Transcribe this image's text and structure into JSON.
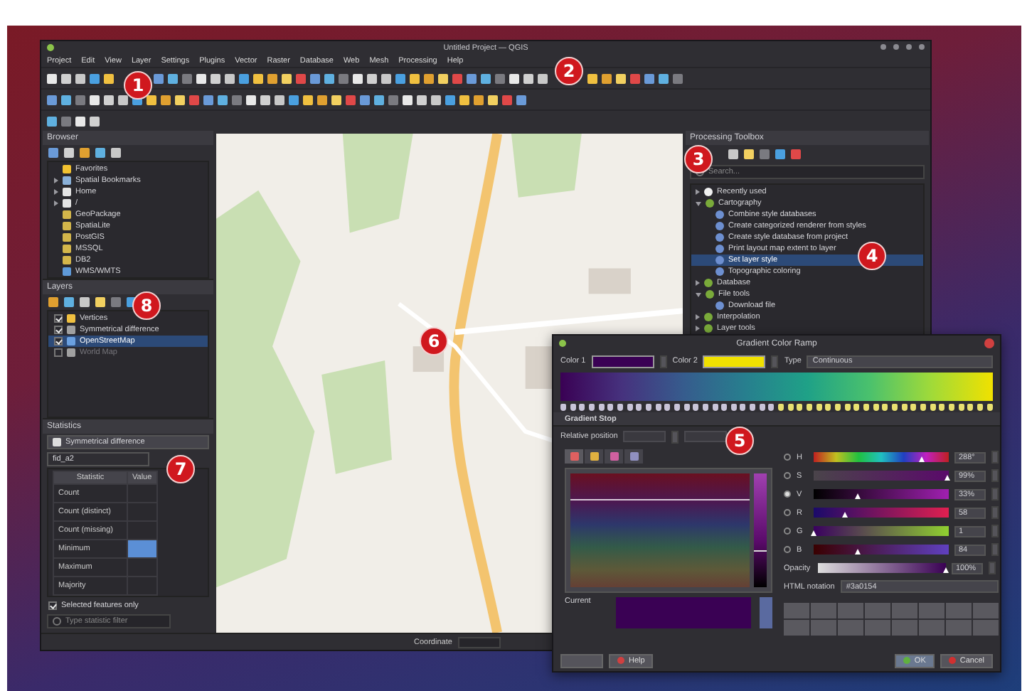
{
  "window": {
    "title": "Untitled Project — QGIS"
  },
  "menu": [
    "Project",
    "Edit",
    "View",
    "Layer",
    "Settings",
    "Plugins",
    "Vector",
    "Raster",
    "Database",
    "Web",
    "Mesh",
    "Processing",
    "Help"
  ],
  "browser": {
    "title": "Browser",
    "items": [
      {
        "label": "Favorites",
        "has_children": false,
        "kind": "star"
      },
      {
        "label": "Spatial Bookmarks",
        "has_children": true,
        "kind": "bookmark"
      },
      {
        "label": "Home",
        "has_children": true,
        "kind": "folder"
      },
      {
        "label": "/",
        "has_children": true,
        "kind": "folder"
      },
      {
        "label": "GeoPackage",
        "has_children": false,
        "kind": "database"
      },
      {
        "label": "SpatiaLite",
        "has_children": false,
        "kind": "database"
      },
      {
        "label": "PostGIS",
        "has_children": false,
        "kind": "database"
      },
      {
        "label": "MSSQL",
        "has_children": false,
        "kind": "database"
      },
      {
        "label": "DB2",
        "has_children": false,
        "kind": "database"
      },
      {
        "label": "WMS/WMTS",
        "has_children": false,
        "kind": "globe"
      }
    ]
  },
  "layers": {
    "title": "Layers",
    "items": [
      {
        "label": "Vertices",
        "checked": true,
        "selected": false,
        "kind": "point"
      },
      {
        "label": "Symmetrical difference",
        "checked": true,
        "selected": false,
        "kind": "polygon"
      },
      {
        "label": "OpenStreetMap",
        "checked": true,
        "selected": true,
        "kind": "tiles"
      },
      {
        "label": "World Map",
        "checked": false,
        "selected": false,
        "kind": "polygon"
      }
    ]
  },
  "statistics": {
    "title": "Statistics",
    "layer": "Symmetrical difference",
    "field": "fid_a2",
    "columns": [
      "Statistic",
      "Value"
    ],
    "rows": [
      {
        "name": "Count",
        "highlighted": false
      },
      {
        "name": "Count (distinct)",
        "highlighted": false
      },
      {
        "name": "Count (missing)",
        "highlighted": false
      },
      {
        "name": "Minimum",
        "highlighted": true
      },
      {
        "name": "Maximum",
        "highlighted": false
      },
      {
        "name": "Majority",
        "highlighted": false
      }
    ],
    "selected_only": {
      "label": "Selected features only",
      "checked": true
    },
    "filter": {
      "placeholder": "Type statistic filter"
    }
  },
  "processing": {
    "title": "Processing Toolbox",
    "search": {
      "placeholder": "Search..."
    },
    "tree": [
      {
        "label": "Recently used",
        "kind": "clock",
        "expanded": false,
        "selected": false
      },
      {
        "label": "Cartography",
        "kind": "group",
        "expanded": true,
        "selected": false,
        "children": [
          {
            "label": "Combine style databases",
            "kind": "algorithm",
            "selected": false
          },
          {
            "label": "Create categorized renderer from styles",
            "kind": "algorithm",
            "selected": false
          },
          {
            "label": "Create style database from project",
            "kind": "algorithm",
            "selected": false
          },
          {
            "label": "Print layout map extent to layer",
            "kind": "algorithm",
            "selected": false
          },
          {
            "label": "Set layer style",
            "kind": "algorithm",
            "selected": true
          },
          {
            "label": "Topographic coloring",
            "kind": "algorithm",
            "selected": false
          }
        ]
      },
      {
        "label": "Database",
        "kind": "group",
        "expanded": false,
        "selected": false
      },
      {
        "label": "File tools",
        "kind": "group",
        "expanded": true,
        "selected": false,
        "children": [
          {
            "label": "Download file",
            "kind": "algorithm",
            "selected": false
          }
        ]
      },
      {
        "label": "Interpolation",
        "kind": "group",
        "expanded": false,
        "selected": false
      },
      {
        "label": "Layer tools",
        "kind": "group",
        "expanded": false,
        "selected": false
      }
    ]
  },
  "status_bar": {
    "coordinate_label": "Coordinate"
  },
  "dialog": {
    "title": "Gradient Color Ramp",
    "colors": [
      {
        "label": "Color 1",
        "color": "#3a0154"
      },
      {
        "label": "Color 2",
        "color": "#f0e100"
      }
    ],
    "type": {
      "label": "Type",
      "value": "Continuous"
    },
    "section": "Gradient Stop",
    "value_slider": {
      "level": 0.33
    },
    "picker_tabs": [
      {
        "selected": true
      },
      {
        "selected": false
      },
      {
        "selected": false
      },
      {
        "selected": false
      }
    ],
    "relative_position": {
      "label": "Relative position"
    },
    "channels": [
      {
        "label": "H",
        "selected": false,
        "level": 0.8,
        "reading": "288°"
      },
      {
        "label": "S",
        "selected": false,
        "level": 0.99,
        "reading": "99%"
      },
      {
        "label": "V",
        "selected": true,
        "level": 0.33,
        "reading": "33%"
      },
      {
        "label": "R",
        "selected": false,
        "level": 0.23,
        "reading": "58"
      },
      {
        "label": "G",
        "selected": false,
        "level": 0.0,
        "reading": "1"
      },
      {
        "label": "B",
        "selected": false,
        "level": 0.33,
        "reading": "84"
      }
    ],
    "opacity": {
      "label": "Opacity",
      "level": 1.0,
      "reading": "100%"
    },
    "html": {
      "label": "HTML notation",
      "value": "#3a0154"
    },
    "current_label": "Current",
    "buttons": [
      {
        "label": "Help",
        "kind": "help"
      },
      {
        "label": "OK",
        "kind": "ok"
      },
      {
        "label": "Cancel",
        "kind": "cancel"
      }
    ]
  },
  "callouts": [
    "1",
    "2",
    "3",
    "4",
    "5",
    "6",
    "7",
    "8"
  ]
}
